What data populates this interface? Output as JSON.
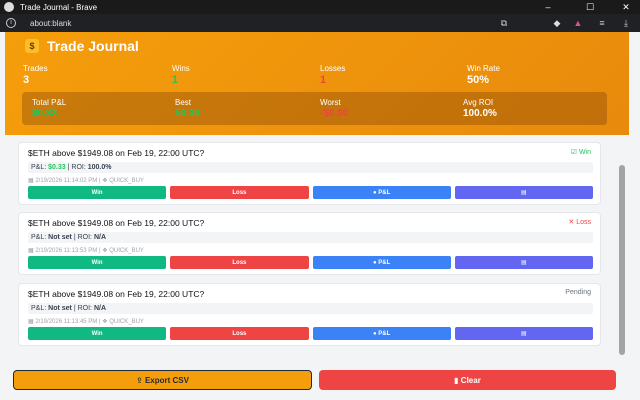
{
  "window": {
    "title": "Trade Journal - Brave"
  },
  "browser": {
    "url": "about:blank"
  },
  "header": {
    "title": "Trade Journal",
    "stats": [
      {
        "label": "Trades",
        "value": "3"
      },
      {
        "label": "Wins",
        "value": "1"
      },
      {
        "label": "Losses",
        "value": "1"
      },
      {
        "label": "Win Rate",
        "value": "50%"
      }
    ],
    "summary": [
      {
        "label": "Total P&L",
        "value": "$0.33"
      },
      {
        "label": "Best",
        "value": "$0.33"
      },
      {
        "label": "Worst",
        "value": "-$0.00"
      },
      {
        "label": "Avg ROI",
        "value": "100.0%"
      }
    ]
  },
  "trades": [
    {
      "question": "$ETH above $1949.08 on Feb 19, 22:00 UTC?",
      "status": "Win",
      "pnl_label": "P&L:",
      "pnl_value": "$0.33",
      "roi_label": "ROI:",
      "roi_value": "100.0%",
      "time": "2/19/2026 11:14:02 PM",
      "source": "QUICK_BUY"
    },
    {
      "question": "$ETH above $1949.08 on Feb 19, 22:00 UTC?",
      "status": "Loss",
      "pnl_label": "P&L:",
      "pnl_value": "Not set",
      "roi_label": "ROI:",
      "roi_value": "N/A",
      "time": "2/19/2026 11:13:53 PM",
      "source": "QUICK_BUY"
    },
    {
      "question": "$ETH above $1949.08 on Feb 19, 22:00 UTC?",
      "status": "Pending",
      "pnl_label": "P&L:",
      "pnl_value": "Not set",
      "roi_label": "ROI:",
      "roi_value": "N/A",
      "time": "2/19/2026 11:13:45 PM",
      "source": "QUICK_BUY"
    }
  ],
  "buttons": {
    "win": "Win",
    "loss": "Loss",
    "pnl": "P&L",
    "note": ""
  },
  "footer": {
    "export": "Export CSV",
    "clear": "Clear"
  },
  "colors": {
    "win": "#22c55e",
    "loss": "#ef4444",
    "pending": "#6b7280",
    "accent": "#f59e0b"
  }
}
